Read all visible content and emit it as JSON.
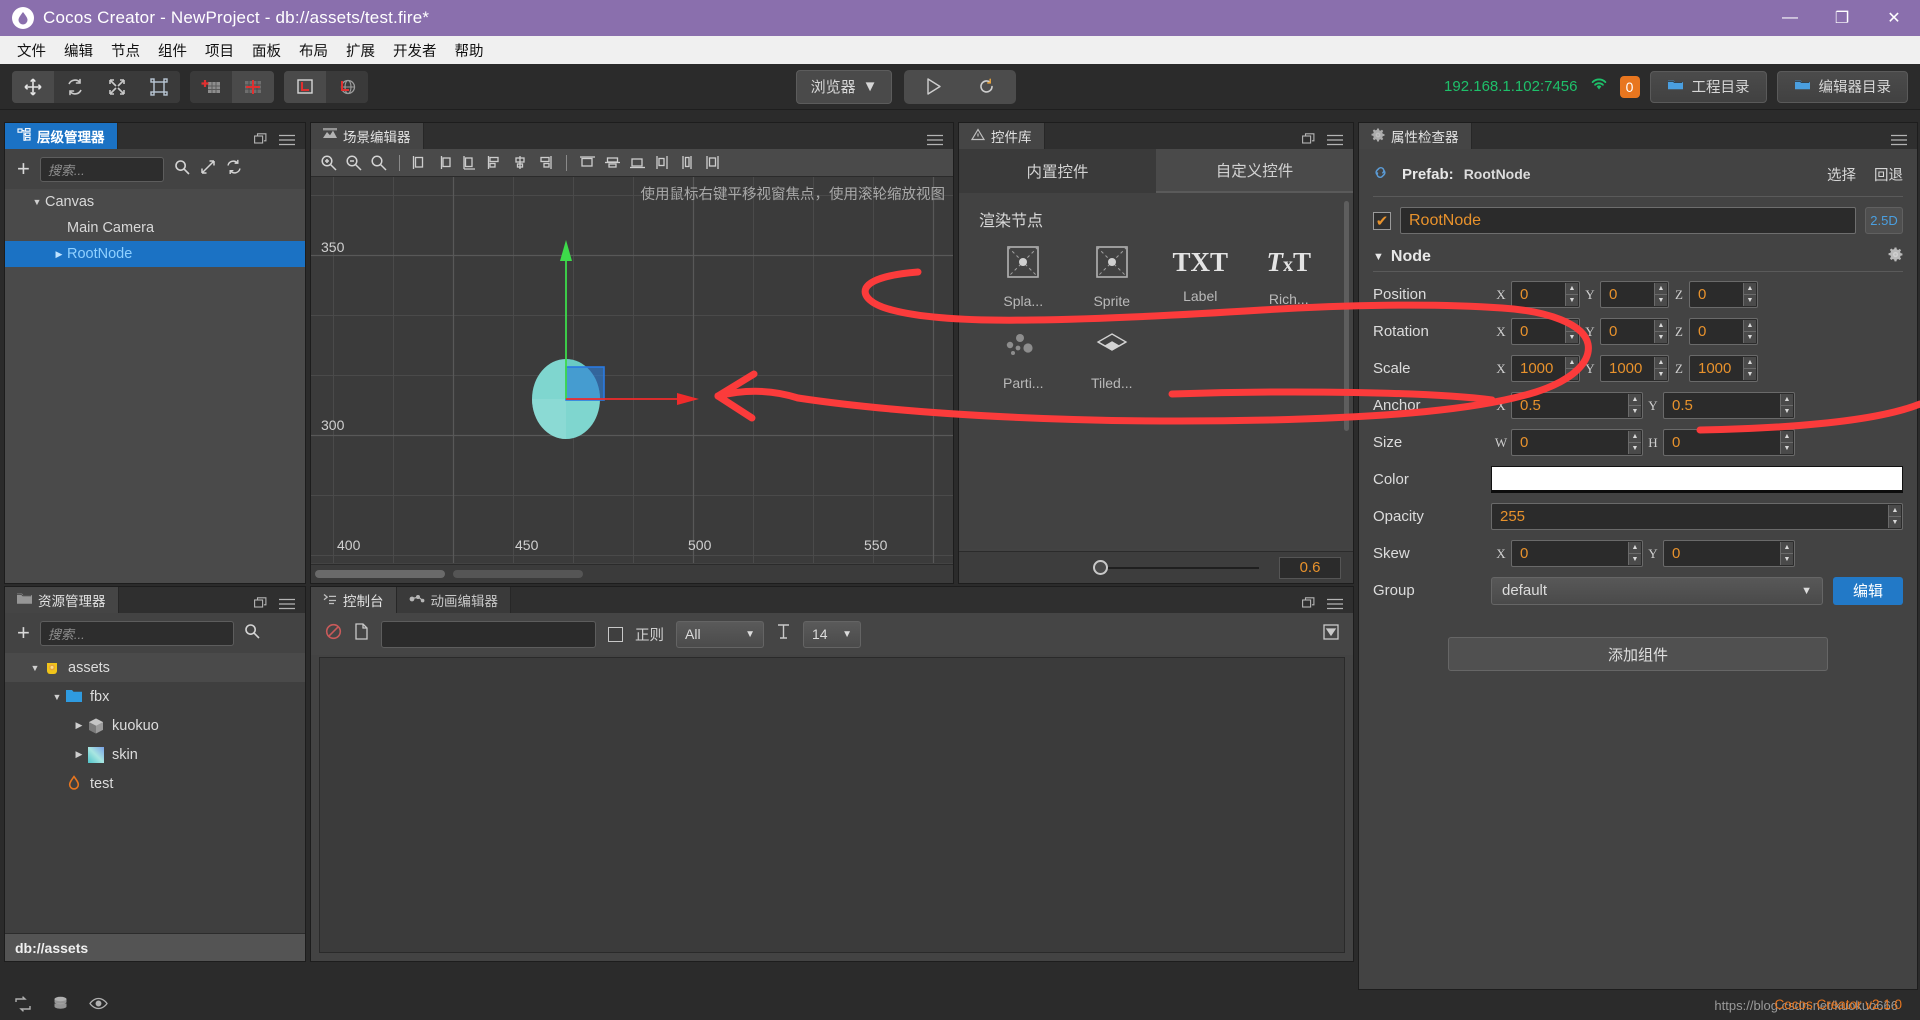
{
  "window": {
    "title": "Cocos Creator - NewProject - db://assets/test.fire*",
    "logo_icon": "cocos-logo-icon",
    "minimize": "—",
    "maximize": "❐",
    "close": "✕",
    "titlebar_color": "#8a6fad"
  },
  "menubar": {
    "items": [
      "文件",
      "编辑",
      "节点",
      "组件",
      "项目",
      "面板",
      "布局",
      "扩展",
      "开发者",
      "帮助"
    ]
  },
  "toolbar": {
    "transform_tools": [
      {
        "name": "move-tool",
        "icon": "move-icon",
        "active": true
      },
      {
        "name": "rotate-tool",
        "icon": "rotate-icon",
        "active": false
      },
      {
        "name": "scale-tool",
        "icon": "scale-icon",
        "active": false
      },
      {
        "name": "rect-tool",
        "icon": "rect-transform-icon",
        "active": false
      }
    ],
    "snap_tools": [
      {
        "name": "pivot-toggle",
        "icon": "pivot-icon",
        "active": false
      },
      {
        "name": "grid-snap-toggle",
        "icon": "grid-snap-icon",
        "active": true
      }
    ],
    "coord_tools": [
      {
        "name": "local-coord-toggle",
        "icon": "local-coordinate-icon",
        "active": true
      },
      {
        "name": "global-coord-toggle",
        "icon": "global-coordinate-icon",
        "active": false
      }
    ],
    "preview_select": "浏览器",
    "play_icon": "play-icon",
    "refresh_icon": "refresh-icon",
    "ip_address": "192.168.1.102:7456",
    "wifi_icon": "wifi-icon",
    "device_count": "0",
    "project_dir_button": "工程目录",
    "editor_dir_button": "编辑器目录",
    "accent_green": "#1ec06a",
    "accent_orange": "#e8761f"
  },
  "hierarchy": {
    "tab_title": "层级管理器",
    "tab_icon": "hierarchy-icon",
    "dock_icon": "dock-icon",
    "menu_icon": "hamburger-icon",
    "add_icon": "plus-icon",
    "search_placeholder": "搜索...",
    "search_icon": "search-icon",
    "expand_icon": "expand-icon",
    "refresh_icon": "refresh-icon",
    "nodes": [
      {
        "label": "Canvas",
        "indent": 1,
        "arrow": "down",
        "selected": false
      },
      {
        "label": "Main Camera",
        "indent": 2,
        "arrow": "none",
        "selected": false
      },
      {
        "label": "RootNode",
        "indent": 2,
        "arrow": "right",
        "selected": true
      }
    ]
  },
  "assets": {
    "tab_title": "资源管理器",
    "tab_icon": "folder-icon",
    "dock_icon": "dock-icon",
    "menu_icon": "hamburger-icon",
    "add_icon": "plus-icon",
    "search_placeholder": "搜索...",
    "search_icon": "search-icon",
    "items": [
      {
        "label": "assets",
        "indent": 1,
        "arrow": "down",
        "icon": "db-asset-icon",
        "highlight": true
      },
      {
        "label": "fbx",
        "indent": 2,
        "arrow": "down",
        "icon": "folder-blue-icon",
        "highlight": false
      },
      {
        "label": "kuokuo",
        "indent": 3,
        "arrow": "right",
        "icon": "mesh-icon",
        "highlight": false
      },
      {
        "label": "skin",
        "indent": 3,
        "arrow": "right",
        "icon": "texture-icon",
        "highlight": false
      },
      {
        "label": "test",
        "indent": 2,
        "arrow": "none",
        "icon": "fire-scene-icon",
        "highlight": false
      }
    ],
    "path": "db://assets"
  },
  "scene": {
    "tab_title": "场景编辑器",
    "tab_icon": "scene-icon",
    "menu_icon": "hamburger-icon",
    "tools": [
      "zoom-in-icon",
      "zoom-out-icon",
      "zoom-reset-icon",
      "divider",
      "align-left-icon",
      "align-center-h-icon",
      "align-right-icon",
      "align-edge-left-icon",
      "align-edge-center-icon",
      "align-edge-right-icon",
      "divider",
      "align-top-icon",
      "align-middle-icon",
      "align-bottom-icon",
      "distribute-h-icon",
      "distribute-v-icon",
      "distribute-both-icon"
    ],
    "hint": "使用鼠标右键平移视窗焦点，使用滚轮缩放视图",
    "ruler_y": [
      "350",
      "300"
    ],
    "ruler_x": [
      "400",
      "450",
      "500",
      "550"
    ],
    "gizmo": {
      "y_axis_color": "#3ddb4a",
      "x_axis_color": "#ef2b2b",
      "node_color": "#7fd6cf",
      "selection_color": "#2a7ae2"
    }
  },
  "console": {
    "tabs": [
      {
        "label": "控制台",
        "icon": "console-icon",
        "active": true
      },
      {
        "label": "动画编辑器",
        "icon": "animation-icon",
        "active": false
      }
    ],
    "dock_icon": "dock-icon",
    "menu_icon": "hamburger-icon",
    "clear_icon": "clear-icon",
    "file_icon": "file-icon",
    "filter_value": "",
    "regex_label": "正则",
    "level_select": "All",
    "text_size_icon": "text-size-icon",
    "font_size": "14",
    "collapse_icon": "collapse-icon"
  },
  "ctrllib": {
    "tab_title": "控件库",
    "tab_icon": "warning-triangle-icon",
    "dock_icon": "dock-icon",
    "menu_icon": "hamburger-icon",
    "tabs": [
      {
        "label": "内置控件",
        "active": true
      },
      {
        "label": "自定义控件",
        "active": false
      }
    ],
    "group_title": "渲染节点",
    "items": [
      {
        "label": "Spla...",
        "icon": "splash-node-icon"
      },
      {
        "label": "Sprite",
        "icon": "sprite-node-icon"
      },
      {
        "label": "Label",
        "icon": "label-txt-icon"
      },
      {
        "label": "Rich...",
        "icon": "richtext-txt-icon"
      },
      {
        "label": "Parti...",
        "icon": "particle-icon"
      },
      {
        "label": "Tiled...",
        "icon": "tiledmap-icon"
      }
    ],
    "zoom_value": "0.6"
  },
  "inspector": {
    "tab_title": "属性检查器",
    "tab_icon": "gear-icon",
    "menu_icon": "hamburger-icon",
    "prefab_icon": "prefab-link-icon",
    "prefab_label": "Prefab:",
    "prefab_name": "RootNode",
    "prefab_select": "选择",
    "prefab_revert": "回退",
    "node_enabled": true,
    "node_name": "RootNode",
    "mode_badge": "2.5D",
    "section_title": "Node",
    "section_gear_icon": "gear-icon",
    "properties": [
      {
        "label": "Position",
        "fields": [
          {
            "axis": "X",
            "value": "0"
          },
          {
            "axis": "Y",
            "value": "0"
          },
          {
            "axis": "Z",
            "value": "0"
          }
        ]
      },
      {
        "label": "Rotation",
        "fields": [
          {
            "axis": "X",
            "value": "0"
          },
          {
            "axis": "Y",
            "value": "0"
          },
          {
            "axis": "Z",
            "value": "0"
          }
        ]
      },
      {
        "label": "Scale",
        "fields": [
          {
            "axis": "X",
            "value": "1000"
          },
          {
            "axis": "Y",
            "value": "1000"
          },
          {
            "axis": "Z",
            "value": "1000"
          }
        ]
      },
      {
        "label": "Anchor",
        "fields": [
          {
            "axis": "X",
            "value": "0.5"
          },
          {
            "axis": "Y",
            "value": "0.5"
          }
        ]
      },
      {
        "label": "Size",
        "fields": [
          {
            "axis": "W",
            "value": "0"
          },
          {
            "axis": "H",
            "value": "0"
          }
        ]
      }
    ],
    "color_label": "Color",
    "color_value": "#ffffff",
    "opacity_label": "Opacity",
    "opacity_value": "255",
    "skew_label": "Skew",
    "skew_fields": [
      {
        "axis": "X",
        "value": "0"
      },
      {
        "axis": "Y",
        "value": "0"
      }
    ],
    "group_label": "Group",
    "group_value": "default",
    "group_edit_button": "编辑",
    "add_component_button": "添加组件",
    "value_color": "#e8922c"
  },
  "statusbar": {
    "icons": [
      "sync-icon",
      "database-icon",
      "eye-icon"
    ],
    "version": "Cocos Creator v2.1.0",
    "watermark": "https://blog.csdn.net/kuokuo666"
  },
  "annotation": {
    "color": "#fb3b3b",
    "description": "red hand-drawn arrow pointing at the Scale row"
  }
}
